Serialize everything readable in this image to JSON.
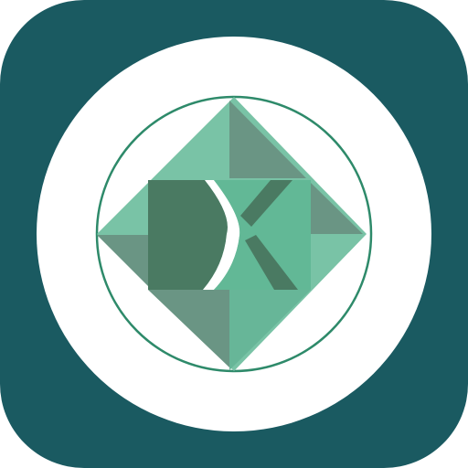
{
  "icon": {
    "name": "app-icon",
    "logo": "dx-diamond-logo",
    "colors": {
      "background_tile": "#1a5a61",
      "white_disc": "#ffffff",
      "ring": "#2e8a6a",
      "diamond_light": "#79c3a6",
      "diamond_mid": "#67b698",
      "diamond_gray_green": "#6a9584",
      "letter_dark": "#4a7a62",
      "letter_x_fill": "#62b896"
    }
  }
}
